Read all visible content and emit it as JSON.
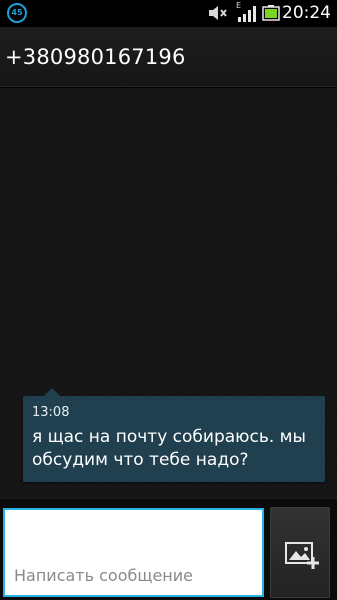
{
  "status_bar": {
    "notification_count": "45",
    "network_type": "E",
    "time": "20:24",
    "icons": [
      "notification-badge",
      "muted-speaker-icon",
      "signal-icon",
      "battery-icon"
    ]
  },
  "header": {
    "contact": "+380980167196"
  },
  "messages": [
    {
      "time": "13:08",
      "text": "я щас на почту собираюсь. мы обсудим что тебе надо?"
    }
  ],
  "compose": {
    "placeholder": "Написать сообщение",
    "attach_icon": "add-picture-icon"
  },
  "colors": {
    "accent": "#26b5e3",
    "bubble": "#20404f",
    "battery": "#7dd321"
  }
}
